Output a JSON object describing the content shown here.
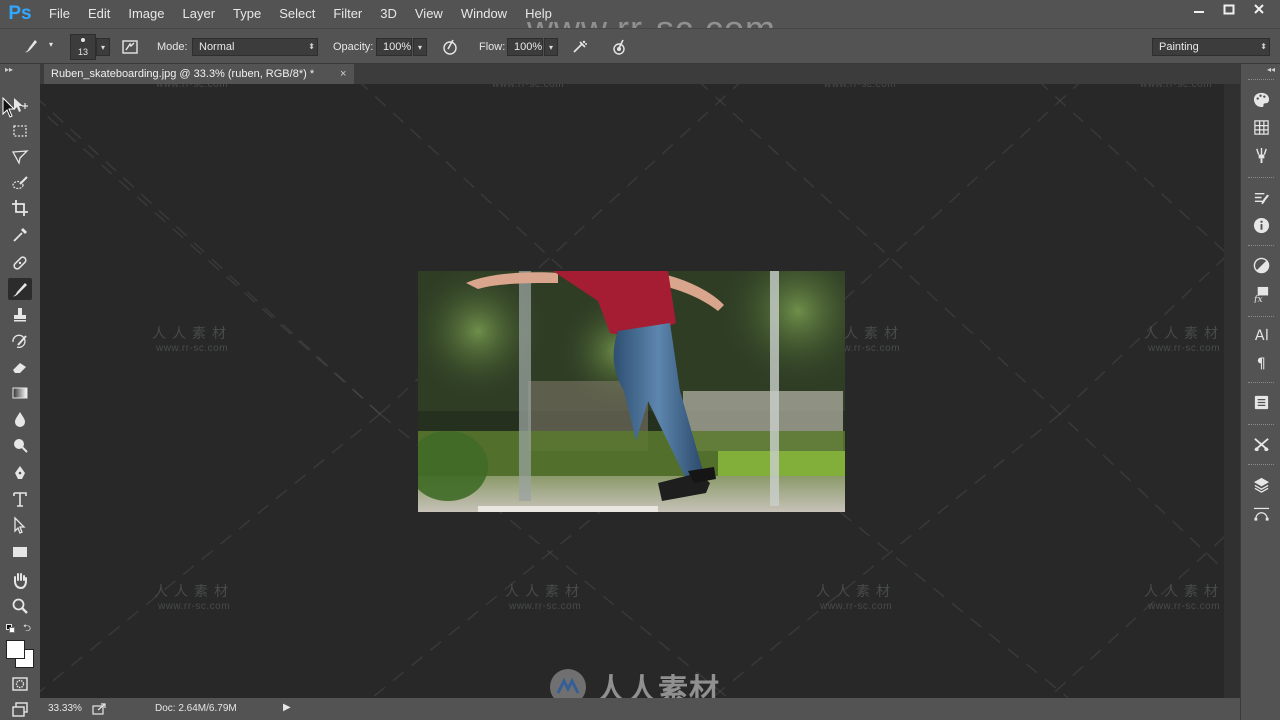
{
  "app": {
    "logo": "Ps",
    "menu": [
      "File",
      "Edit",
      "Image",
      "Layer",
      "Type",
      "Select",
      "Filter",
      "3D",
      "View",
      "Window",
      "Help"
    ],
    "window_controls": [
      "minimize-icon",
      "restore-icon",
      "close-icon"
    ]
  },
  "watermark": {
    "top_url": "www.rr-sc.com",
    "tile_cn": "人人素材",
    "tile_url": "www.rr-sc.com",
    "bottom_logo_text": "人人素材"
  },
  "options_bar": {
    "brush_size": "13",
    "mode_label": "Mode:",
    "mode_value": "Normal",
    "opacity_label": "Opacity:",
    "opacity_value": "100%",
    "flow_label": "Flow:",
    "flow_value": "100%",
    "workspace": "Painting"
  },
  "document": {
    "tab_title": "Ruben_skateboarding.jpg @ 33.3% (ruben, RGB/8*) *",
    "close_glyph": "×"
  },
  "status": {
    "zoom": "33.33%",
    "doc_size": "Doc: 2.64M/6.79M",
    "arrow_glyph": "▶"
  },
  "toolbox": [
    "move-tool-icon",
    "marquee-tool-icon",
    "lasso-tool-icon",
    "quick-selection-tool-icon",
    "crop-tool-icon",
    "eyedropper-tool-icon",
    "healing-brush-tool-icon",
    "brush-tool-icon",
    "clone-stamp-tool-icon",
    "history-brush-tool-icon",
    "eraser-tool-icon",
    "gradient-tool-icon",
    "blur-tool-icon",
    "dodge-tool-icon",
    "pen-tool-icon",
    "type-tool-icon",
    "path-selection-tool-icon",
    "rectangle-tool-icon",
    "hand-tool-icon",
    "zoom-tool-icon"
  ],
  "colors": {
    "foreground": "#ffffff",
    "background": "#ffffff",
    "ui_panel": "#535353",
    "canvas_bg": "#282828",
    "ps_blue": "#31a8ff"
  }
}
